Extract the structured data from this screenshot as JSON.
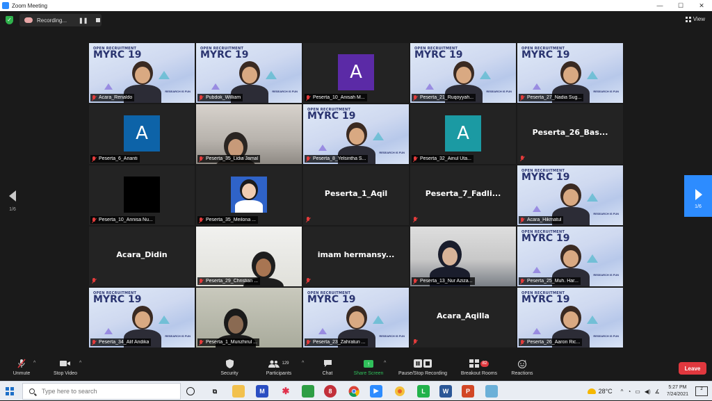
{
  "window": {
    "title": "Zoom Meeting",
    "minimize": "—",
    "maximize": "☐",
    "close": "✕"
  },
  "topbar": {
    "recording_label": "Recording...",
    "pause_icon": "❚❚",
    "view_label": "View"
  },
  "pagination": {
    "left_page": "1/6",
    "right_page": "1/6"
  },
  "tiles": [
    {
      "name": "Acara_Renaldo",
      "type": "banner",
      "active": true
    },
    {
      "name": "Pubdok_William",
      "type": "banner"
    },
    {
      "name": "Peserta_10_Anisah M...",
      "type": "avatar",
      "letter": "A",
      "color": "#5b2aa6"
    },
    {
      "name": "Peserta_21_Ruqoyyah...",
      "type": "banner"
    },
    {
      "name": "Peserta_27_Nadia Sug...",
      "type": "banner"
    },
    {
      "name": "Peserta_6_Arianti",
      "type": "avatar",
      "letter": "A",
      "color": "#0d63a8"
    },
    {
      "name": "Peserta_35_Lidia Jamal",
      "type": "room"
    },
    {
      "name": "Peserta_8_Yelsintha S...",
      "type": "banner"
    },
    {
      "name": "Peserta_32_Ainul Uta...",
      "type": "avatar",
      "letter": "A",
      "color": "#1b9aa3"
    },
    {
      "name": "",
      "type": "bigname",
      "display": "Peserta_26_Bas..."
    },
    {
      "name": "Peserta_10_Annisa Nu...",
      "type": "avatar",
      "letter": "",
      "color": "#000000"
    },
    {
      "name": "Peserta_35_Meilona ...",
      "type": "photo"
    },
    {
      "name": "",
      "type": "bigname",
      "display": "Peserta_1_Aqil"
    },
    {
      "name": "",
      "type": "bigname",
      "display": "Peserta_7_Fadli..."
    },
    {
      "name": "Acara_Hikmatul",
      "type": "banner"
    },
    {
      "name": "",
      "type": "bigname",
      "display": "Acara_Didin"
    },
    {
      "name": "Peserta_29_Christian ...",
      "type": "roomwhite"
    },
    {
      "name": "",
      "type": "bigname",
      "display": "imam  hermansy..."
    },
    {
      "name": "Peserta_13_Nur Aziza...",
      "type": "ceiling"
    },
    {
      "name": "Peserta_25_Muh. Har...",
      "type": "banner"
    },
    {
      "name": "Peserta_34_Alif Andika",
      "type": "banner"
    },
    {
      "name": "Peserta_1_Munzhirul ...",
      "type": "roomgreen"
    },
    {
      "name": "Peserta_23_Zahratun ...",
      "type": "banner"
    },
    {
      "name": "",
      "type": "bigname",
      "display": "Acara_Aqilla"
    },
    {
      "name": "Peserta_26_Aaron Ric...",
      "type": "banner"
    }
  ],
  "banner": {
    "small": "OPEN RECRUITMENT",
    "big": "MYRC 19",
    "tag": "RESEARCH IS FUN"
  },
  "toolbar": {
    "unmute": "Unmute",
    "stop_video": "Stop Video",
    "security": "Security",
    "participants": "Participants",
    "participants_count": "129",
    "chat": "Chat",
    "share_screen": "Share Screen",
    "pause_stop_recording": "Pause/Stop Recording",
    "breakout_rooms": "Breakout Rooms",
    "breakout_badge": "82",
    "reactions": "Reactions",
    "leave": "Leave"
  },
  "taskbar": {
    "search_placeholder": "Type here to search",
    "temperature": "28°C",
    "time": "5:27 PM",
    "date": "7/24/2021",
    "notif_count": "2"
  },
  "colors": {
    "accent": "#2d8cff",
    "leave": "#e0383e",
    "active_border": "#c7e43a",
    "share": "#30c05b"
  }
}
